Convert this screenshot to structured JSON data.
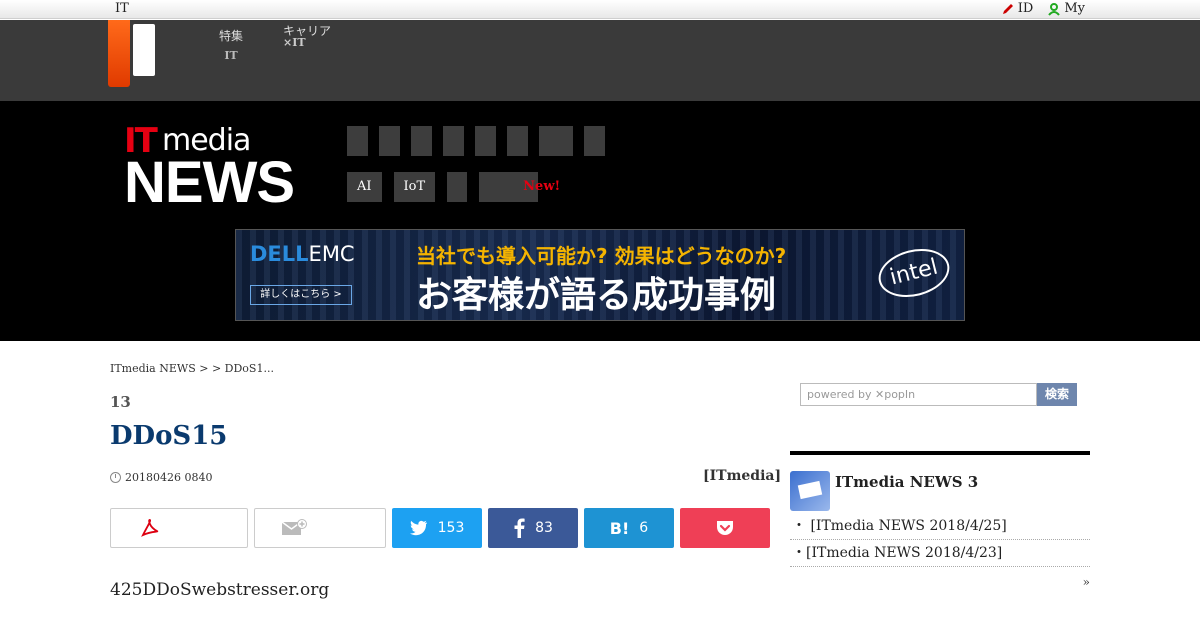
{
  "topbar": {
    "brand": "IT",
    "id_link": "ID",
    "my_link": "My"
  },
  "portal": {
    "nav1_top": "特集",
    "nav1_bottom": "IT",
    "nav2_top": "キャリア",
    "nav2_bottom": "×IT"
  },
  "header": {
    "logo_it": "IT",
    "logo_media": "media",
    "logo_news": "NEWS",
    "tags": [
      "AI",
      "IoT"
    ],
    "new_badge": "New!"
  },
  "banner": {
    "brand": "DELL",
    "brand2": "EMC",
    "button": "詳しくはこちら >",
    "headline1": "当社でも導入可能か? 効果はどうなのか?",
    "headline2": "お客様が語る成功事例",
    "intel": "intel"
  },
  "article": {
    "breadcrumb": "ITmedia NEWS >  > DDoS1...",
    "series": "13",
    "title": "DDoS15",
    "date": "20180426 0840",
    "source": "[ITmedia]",
    "lead": "425DDoSwebstresser.org"
  },
  "share": {
    "twitter_count": "153",
    "facebook_count": "83",
    "hatena_label": "B!",
    "hatena_count": "6"
  },
  "sidebar": {
    "search_placeholder": "powered by ✕popIn",
    "search_button": "検索",
    "box_title": "ITmedia NEWS 3",
    "items": [
      "・ [ITmedia NEWS   2018/4/25]",
      "・[ITmedia NEWS   2018/4/23]"
    ],
    "more": "»"
  },
  "colors": {
    "accent_red": "#e60012",
    "title_blue": "#0a3a6e",
    "twitter": "#1da1f2",
    "facebook": "#3b5998",
    "hatena": "#1e93d3",
    "pocket": "#ef3f56"
  }
}
